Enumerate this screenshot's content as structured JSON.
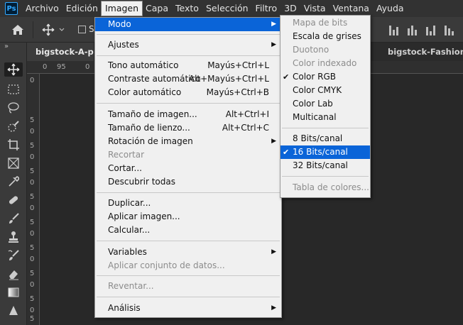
{
  "app": {
    "logo": "Ps"
  },
  "menubar": {
    "items": [
      "Archivo",
      "Edición",
      "Imagen",
      "Capa",
      "Texto",
      "Selección",
      "Filtro",
      "3D",
      "Vista",
      "Ventana",
      "Ayuda"
    ],
    "active": "Imagen"
  },
  "options_bar": {
    "checkbox_label": "S",
    "icons": [
      "home-icon",
      "move-icon",
      "chevron-down-icon",
      "align-icons"
    ]
  },
  "document_tabs": [
    {
      "label": "bigstock-A-port",
      "active": true
    },
    {
      "label": "bigstock-Fashion-sho",
      "active": false
    }
  ],
  "ruler": {
    "h_labels": [
      "0",
      "95",
      "0"
    ],
    "v_labels": [
      "0",
      "5",
      "0",
      "5",
      "0",
      "5",
      "0",
      "5",
      "0",
      "5",
      "0",
      "5",
      "0",
      "5",
      "0",
      "5",
      "0",
      "5"
    ]
  },
  "image_menu": {
    "items": [
      {
        "label": "Modo",
        "submenu": true,
        "highlighted": true
      },
      {
        "label": "Ajustes",
        "submenu": true
      },
      {
        "label": "Tono automático",
        "shortcut": "Mayús+Ctrl+L"
      },
      {
        "label": "Contraste automático",
        "shortcut": "Alt+Mayús+Ctrl+L"
      },
      {
        "label": "Color automático",
        "shortcut": "Mayús+Ctrl+B"
      },
      {
        "label": "Tamaño de imagen...",
        "shortcut": "Alt+Ctrl+I"
      },
      {
        "label": "Tamaño de lienzo...",
        "shortcut": "Alt+Ctrl+C"
      },
      {
        "label": "Rotación de imagen",
        "submenu": true
      },
      {
        "label": "Recortar",
        "disabled": true
      },
      {
        "label": "Cortar..."
      },
      {
        "label": "Descubrir todas"
      },
      {
        "label": "Duplicar..."
      },
      {
        "label": "Aplicar imagen..."
      },
      {
        "label": "Calcular..."
      },
      {
        "label": "Variables",
        "submenu": true
      },
      {
        "label": "Aplicar conjunto de datos...",
        "disabled": true
      },
      {
        "label": "Reventar...",
        "disabled": true
      },
      {
        "label": "Análisis",
        "submenu": true
      }
    ]
  },
  "mode_submenu": {
    "items": [
      {
        "label": "Mapa de bits",
        "disabled": true
      },
      {
        "label": "Escala de grises"
      },
      {
        "label": "Duotono",
        "disabled": true
      },
      {
        "label": "Color indexado",
        "disabled": true
      },
      {
        "label": "Color RGB",
        "checked": true
      },
      {
        "label": "Color CMYK"
      },
      {
        "label": "Color Lab"
      },
      {
        "label": "Multicanal"
      },
      {
        "label": "8 Bits/canal"
      },
      {
        "label": "16 Bits/canal",
        "checked": true,
        "highlighted": true
      },
      {
        "label": "32 Bits/canal"
      },
      {
        "label": "Tabla de colores...",
        "disabled": true
      }
    ]
  },
  "colors": {
    "highlight": "#0a64d8",
    "menu_bg": "#f0f0f0",
    "app_bg": "#282828",
    "panel_bg": "#3a3a3a"
  }
}
